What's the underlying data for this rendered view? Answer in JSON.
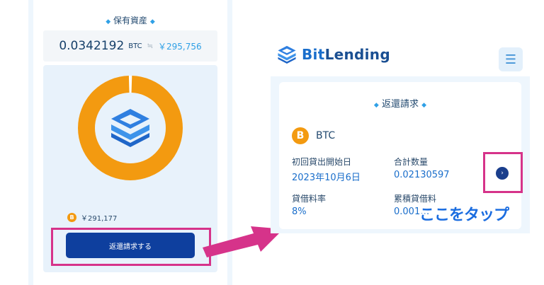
{
  "left": {
    "section_title": "保有資産",
    "asset_amount": "0.0342192",
    "asset_unit": "BTC",
    "approx_symbol": "≒",
    "asset_yen": "￥295,756",
    "donut": {
      "fill_fraction": 0.99,
      "ring_color": "#f39a10",
      "gap_color": "#ffffff"
    },
    "legend_coin_symbol": "B",
    "legend_value": "￥291,177",
    "return_button_label": "返還請求する"
  },
  "right": {
    "brand_part1": "Bit",
    "brand_part2": "Lending",
    "menu_icon": "☰",
    "card_title": "返還請求",
    "coin_symbol": "B",
    "coin_name": "BTC",
    "fields": [
      {
        "label": "初回貸出開始日",
        "value": "2023年10月6日"
      },
      {
        "label": "合計数量",
        "value": "0.02130597"
      },
      {
        "label": "貸借料率",
        "value": "8%"
      },
      {
        "label": "累積貸借料",
        "value": "0.001…"
      }
    ],
    "next_icon": "›"
  },
  "annotation": {
    "tap_label": "ここをタップ",
    "highlight_color": "#d6338a"
  },
  "colors": {
    "accent": "#1a6ecb",
    "button": "#0e3f9e",
    "bitcoin": "#f39a10"
  }
}
